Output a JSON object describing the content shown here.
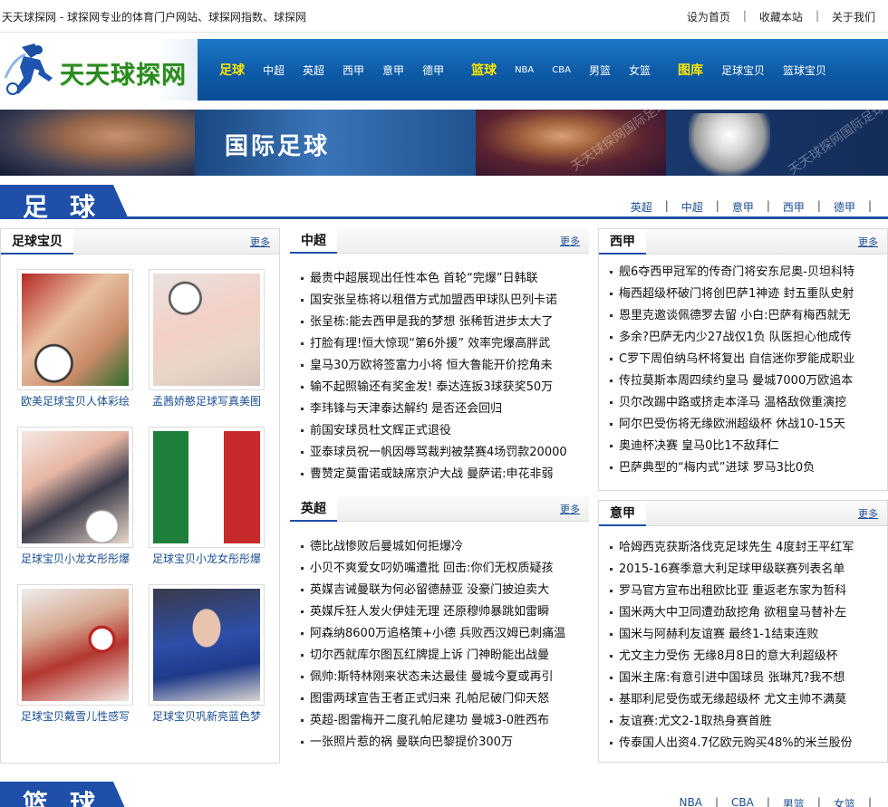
{
  "topbar": {
    "slogan": "天天球探网 - 球探网专业的体育门户网站、球探网指数、球探网",
    "links": [
      "设为首页",
      "收藏本站",
      "关于我们"
    ],
    "sep": "|"
  },
  "nav": {
    "logo_text": "天天球探网",
    "items": [
      {
        "label": "足球",
        "highlight": true
      },
      {
        "label": "中超"
      },
      {
        "label": "英超"
      },
      {
        "label": "西甲"
      },
      {
        "label": "意甲"
      },
      {
        "label": "德甲"
      },
      {
        "label": "篮球",
        "highlight": true
      },
      {
        "label": "NBA"
      },
      {
        "label": "CBA"
      },
      {
        "label": "男篮"
      },
      {
        "label": "女篮"
      },
      {
        "label": "图库",
        "highlight": true
      },
      {
        "label": "足球宝贝"
      },
      {
        "label": "篮球宝贝"
      }
    ]
  },
  "banner": {
    "title": "国际足球",
    "watermark": "天天球探网国际足球"
  },
  "football": {
    "title": "足球",
    "sublinks": [
      "英超",
      "中超",
      "意甲",
      "西甲",
      "德甲"
    ],
    "sep": "|"
  },
  "babes": {
    "title": "足球宝贝",
    "more": "更多",
    "photos": [
      {
        "caption": "欧美足球宝贝人体彩绘"
      },
      {
        "caption": "孟茜娇憨足球写真美图"
      },
      {
        "caption": "足球宝贝小龙女彤彤爆"
      },
      {
        "caption": "足球宝贝小龙女彤彤爆"
      },
      {
        "caption": "足球宝贝戴雪儿性感写"
      },
      {
        "caption": "足球宝贝巩新亮蓝色梦"
      }
    ]
  },
  "csl": {
    "title": "中超",
    "more": "更多",
    "items": [
      "最贵中超展现出任性本色 首轮“完爆”日韩联",
      "国安张呈栋将以租借方式加盟西甲球队巴列卡诺",
      "张呈栋:能去西甲是我的梦想 张稀哲进步太大了",
      "打脸有理!恒大惊现“第6外援” 效率完爆高胖武",
      "皇马30万欧将签富力小将 恒大鲁能开价挖角未",
      "输不起照输还有奖金发! 泰达连扳3球获奖50万",
      "李玮锋与天津泰达解约 是否还会回归",
      "前国安球员杜文辉正式退役",
      "亚泰球员祝一帆因辱骂裁判被禁赛4场罚款20000",
      "曹赞定莫雷诺或缺席京沪大战 曼萨诺:申花非弱"
    ]
  },
  "epl": {
    "title": "英超",
    "more": "更多",
    "items": [
      "德比战惨败后曼城如何拒爆冷",
      "小贝不爽爱女叼奶嘴遭批 回击:你们无权质疑孩",
      "英媒吉诫曼联为何必留德赫亚 没豪门披迫卖大",
      "英媒斥狂人发火伊娃无理 还原穆帅暴跳如雷瞬",
      "阿森纳8600万追格策+小德 兵败西汉姆已刺痛温",
      "切尔西就库尔图瓦红牌提上诉 门神盼能出战曼",
      "佩帅:斯特林刚来状态未达最佳 曼城今夏或再引",
      "图雷两球宣告王者正式归来 孔帕尼破门仰天怒",
      "英超-图雷梅开二度孔帕尼建功 曼城3-0胜西布",
      "一张照片惹的祸 曼联向巴黎提价300万"
    ]
  },
  "laliga": {
    "title": "西甲",
    "more": "更多",
    "items": [
      "舰6夺西甲冠军的传奇门将安东尼奥-贝坦科特",
      "梅西超级杯破门将创巴萨1神迹 封五重队史射",
      "恩里克邀谈佩德罗去留 小白:巴萨有梅西就无",
      "多余?巴萨无内少27战仅1负 队医担心他成传",
      "C罗下周伯纳乌杯将复出 自信迷你罗能成职业",
      "传拉莫斯本周四续约皇马 曼城7000万欧追本",
      "贝尔改踢中路或挤走本泽马 温格敌傚重演挖",
      "阿尔巴受伤将无缘欧洲超级杯 休战10-15天",
      "奥迪杯决赛 皇马0比1不敌拜仁",
      "巴萨典型的“梅内式”进球 罗马3比0负"
    ]
  },
  "seriea": {
    "title": "意甲",
    "more": "更多",
    "items": [
      "哈姆西克获斯洛伐克足球先生 4度封王平红军",
      "2015-16赛季意大利足球甲级联赛列表名单",
      "罗马官方宣布出租欧比亚 重返老东家为哲科",
      "国米两大中卫同遭劲敌挖角 欲租皇马替补左",
      "国米与阿赫利友谊赛 最终1-1结束连败",
      "尤文主力受伤 无缘8月8日的意大利超级杯",
      "国米主席:有意引进中国球员 张琳芃?我不想",
      "基耶利尼受伤或无缘超级杯 尤文主帅不满莫",
      "友谊赛:尤文2-1取热身赛首胜",
      "传泰国人出资4.7亿欧元购买48%的米兰股份"
    ]
  },
  "basketball": {
    "title": "篮球",
    "sublinks": [
      "NBA",
      "CBA",
      "男篮",
      "女篮"
    ],
    "sep": "|"
  }
}
